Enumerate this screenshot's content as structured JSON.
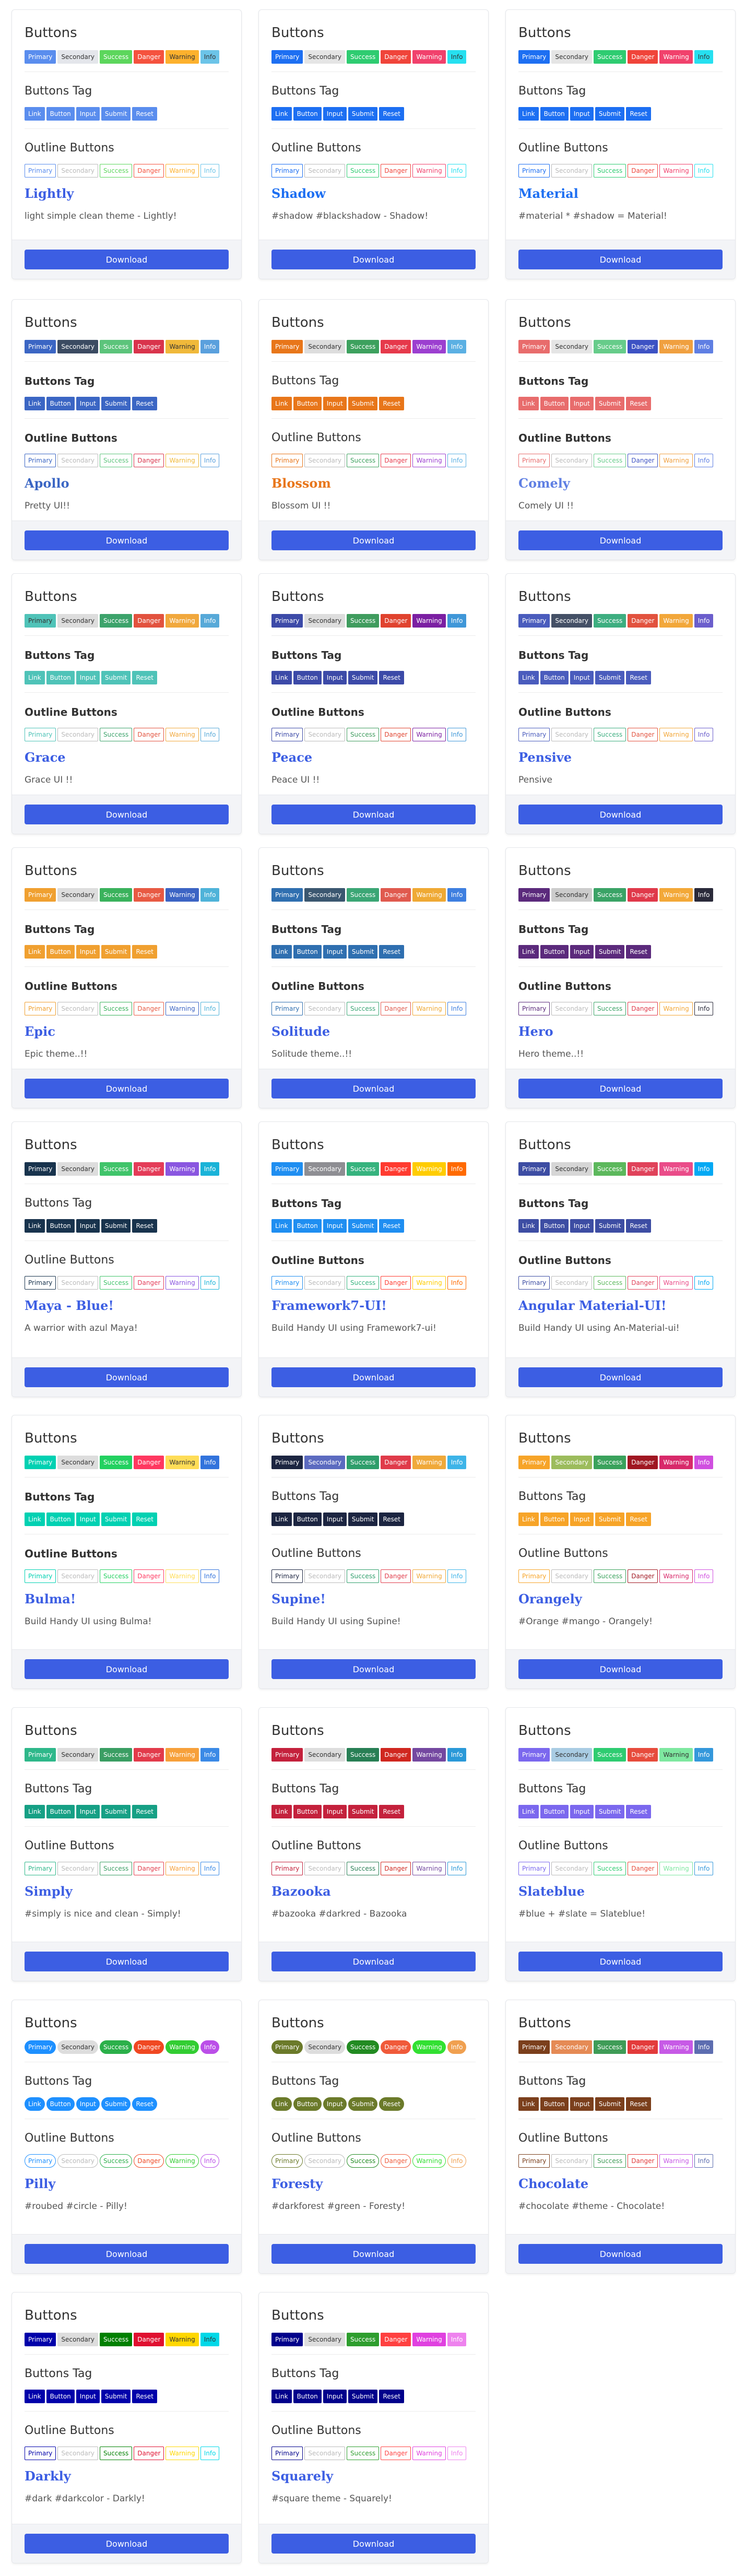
{
  "labels": {
    "main_heading": "Buttons",
    "tag_heading": "Buttons Tag",
    "outline_heading": "Outline Buttons",
    "download": "Download",
    "buttons": [
      "Primary",
      "Secondary",
      "Success",
      "Danger",
      "Warning",
      "Info"
    ],
    "tags": [
      "Link",
      "Button",
      "Input",
      "Submit",
      "Reset"
    ]
  },
  "themes": [
    {
      "name": "Lightly",
      "desc": "light simple clean theme - Lightly!",
      "titleColor": "#3c5ee3",
      "subBold": false,
      "colors": [
        "#5a8dee",
        "#e4e6eb",
        "#5cd65c",
        "#f5523e",
        "#fdb12d",
        "#6cc4e8"
      ],
      "textDark": [
        1,
        4,
        5
      ],
      "tagColor": "#5a8dee",
      "round": false
    },
    {
      "name": "Shadow",
      "desc": "#shadow #blackshadow - Shadow!",
      "titleColor": "#1d6ff2",
      "subBold": false,
      "colors": [
        "#1d6ff2",
        "#e5e5e5",
        "#2ecc71",
        "#f0443a",
        "#f1416c",
        "#26e0f0"
      ],
      "textDark": [
        1,
        5
      ],
      "tagColor": "#1d6ff2",
      "round": false
    },
    {
      "name": "Material",
      "desc": "#material * #shadow = Material!",
      "titleColor": "#1d6ff2",
      "subBold": false,
      "colors": [
        "#1d6ff2",
        "#e5e5e5",
        "#2ecc71",
        "#f0443a",
        "#f1416c",
        "#26e0f0"
      ],
      "textDark": [
        1,
        5
      ],
      "tagColor": "#1d6ff2",
      "round": false
    },
    {
      "name": "Apollo",
      "desc": "Pretty UI!!",
      "titleColor": "#3b66c4",
      "subBold": true,
      "colors": [
        "#3b66c4",
        "#3b4b62",
        "#5cc47b",
        "#d9344c",
        "#f0b93a",
        "#5aa0dd"
      ],
      "textDark": [
        4
      ],
      "tagColor": "#3b66c4",
      "round": false
    },
    {
      "name": "Blossom",
      "desc": "Blossom UI !!",
      "titleColor": "#e8761a",
      "subBold": false,
      "colors": [
        "#e8761a",
        "#dddddd",
        "#3da15e",
        "#e6394b",
        "#9c3fd0",
        "#5bb0e3"
      ],
      "textDark": [
        1
      ],
      "tagColor": "#e8761a",
      "round": false
    },
    {
      "name": "Comely",
      "desc": "Comely UI !!",
      "titleColor": "#5f7fe3",
      "subBold": true,
      "colors": [
        "#e86c6c",
        "#e5e5e5",
        "#66cc8a",
        "#3d52c4",
        "#f0a040",
        "#5f7fe3"
      ],
      "textDark": [
        1
      ],
      "tagColor": "#e86c6c",
      "round": false
    },
    {
      "name": "Grace",
      "desc": "Grace UI !!",
      "titleColor": "#3c5ee3",
      "subBold": true,
      "colors": [
        "#4fc3b8",
        "#dddddd",
        "#3ca36b",
        "#e2523e",
        "#f1a83c",
        "#57a9d8"
      ],
      "textDark": [
        0,
        1
      ],
      "tagColor": "#4fc3b8",
      "round": false
    },
    {
      "name": "Peace",
      "desc": "Peace UI !!",
      "titleColor": "#3c5ee3",
      "subBold": true,
      "colors": [
        "#3c4aa8",
        "#dddddd",
        "#3f9c5e",
        "#e0422e",
        "#7b1fa2",
        "#3f97d8"
      ],
      "textDark": [
        1
      ],
      "tagColor": "#3c4aa8",
      "round": false
    },
    {
      "name": "Pensive",
      "desc": "Pensive",
      "titleColor": "#3c5ee3",
      "subBold": true,
      "colors": [
        "#4a5cbd",
        "#445066",
        "#3dae80",
        "#e2523e",
        "#f2a73a",
        "#6b5ecc"
      ],
      "textDark": [],
      "tagColor": "#4a5cbd",
      "round": false
    },
    {
      "name": "Epic",
      "desc": "Epic theme..!!",
      "titleColor": "#3c5ee3",
      "subBold": true,
      "colors": [
        "#f0a030",
        "#dddddd",
        "#3ab25c",
        "#e85a43",
        "#3c64c4",
        "#4fb3d9"
      ],
      "textDark": [
        1
      ],
      "tagColor": "#f0a030",
      "round": false
    },
    {
      "name": "Solitude",
      "desc": "Solitude theme..!!",
      "titleColor": "#3c5ee3",
      "subBold": true,
      "colors": [
        "#2f6fb0",
        "#3b5770",
        "#3ba675",
        "#e05a4e",
        "#efa934",
        "#3e7fe0"
      ],
      "textDark": [],
      "tagColor": "#2f6fb0",
      "round": false
    },
    {
      "name": "Hero",
      "desc": "Hero theme..!!",
      "titleColor": "#3c5ee3",
      "subBold": true,
      "colors": [
        "#5b2a7c",
        "#cccccc",
        "#3aa366",
        "#e0394a",
        "#f3a838",
        "#2a2a3a"
      ],
      "textDark": [
        1
      ],
      "tagColor": "#5b2a7c",
      "round": false
    },
    {
      "name": "Maya - Blue!",
      "desc": "A warrior with azul Maya!",
      "titleColor": "#3c5ee3",
      "subBold": false,
      "colors": [
        "#18334d",
        "#dddddd",
        "#40c46a",
        "#e43c58",
        "#8a56e0",
        "#1ab3d8"
      ],
      "textDark": [
        1
      ],
      "tagColor": "#18334d",
      "round": false
    },
    {
      "name": "Framework7-UI!",
      "desc": "Build Handy UI using Framework7-ui!",
      "titleColor": "#3c5ee3",
      "subBold": true,
      "colors": [
        "#1f8ef1",
        "#8e8e93",
        "#36b37e",
        "#ff3b30",
        "#ffcc00",
        "#ff6a00"
      ],
      "textDark": [],
      "tagColor": "#1f8ef1",
      "round": false
    },
    {
      "name": "Angular Material-UI!",
      "desc": "Build Handy UI using An-Material-ui!",
      "titleColor": "#3c5ee3",
      "subBold": true,
      "colors": [
        "#3d4da3",
        "#d6d6d6",
        "#5cb85c",
        "#e0425a",
        "#ea4c89",
        "#03a9f4"
      ],
      "textDark": [
        1
      ],
      "tagColor": "#3d4da3",
      "round": false
    },
    {
      "name": "Bulma!",
      "desc": "Build Handy UI using Bulma!",
      "titleColor": "#3c5ee3",
      "subBold": true,
      "colors": [
        "#00d1b2",
        "#dddddd",
        "#23d160",
        "#ff3860",
        "#ffdd57",
        "#3273dc"
      ],
      "textDark": [
        1,
        4
      ],
      "tagColor": "#00d1b2",
      "round": false
    },
    {
      "name": "Supine!",
      "desc": "Build Handy UI using Supine!",
      "titleColor": "#3c5ee3",
      "subBold": false,
      "colors": [
        "#1c2541",
        "#5c6bc0",
        "#2e9e6b",
        "#e03b4a",
        "#f0a93a",
        "#3db4e8"
      ],
      "textDark": [],
      "tagColor": "#1c2541",
      "round": false
    },
    {
      "name": "Orangely",
      "desc": "#Orange #mango - Orangely!",
      "titleColor": "#3c5ee3",
      "subBold": false,
      "colors": [
        "#f7a428",
        "#9cbc5c",
        "#3aa25c",
        "#a01722",
        "#d8296a",
        "#d04fe0"
      ],
      "textDark": [],
      "tagColor": "#f7a428",
      "round": false
    },
    {
      "name": "Simply",
      "desc": "#simply is nice and clean - Simply!",
      "titleColor": "#3c5ee3",
      "subBold": false,
      "colors": [
        "#2eb88a",
        "#dddddd",
        "#3a9e63",
        "#e23b4b",
        "#f7a03a",
        "#3b8ae6"
      ],
      "textDark": [
        1
      ],
      "tagColor": "#16a085",
      "round": false
    },
    {
      "name": "Bazooka",
      "desc": "#bazooka #darkred - Bazooka",
      "titleColor": "#3c5ee3",
      "subBold": false,
      "colors": [
        "#c4213c",
        "#dddddd",
        "#287f55",
        "#d0271f",
        "#7448a0",
        "#2a99d8"
      ],
      "textDark": [
        1
      ],
      "tagColor": "#c4213c",
      "round": false
    },
    {
      "name": "Slateblue",
      "desc": "#blue + #slate = Slateblue!",
      "titleColor": "#3c5ee3",
      "subBold": false,
      "colors": [
        "#7b68ee",
        "#a9cce3",
        "#2ecc71",
        "#e74c3c",
        "#7ee8a0",
        "#3498db"
      ],
      "textDark": [
        1,
        4
      ],
      "tagColor": "#7b68ee",
      "round": false
    },
    {
      "name": "Pilly",
      "desc": "#roubed #circle - Pilly!",
      "titleColor": "#3c5ee3",
      "subBold": false,
      "colors": [
        "#1e90ff",
        "#dddddd",
        "#2bb04a",
        "#f04822",
        "#32cd32",
        "#bb4fe8"
      ],
      "textDark": [
        1
      ],
      "tagColor": "#1e90ff",
      "round": true
    },
    {
      "name": "Foresty",
      "desc": "#darkforest #green - Foresty!",
      "titleColor": "#3c5ee3",
      "subBold": false,
      "colors": [
        "#6b7a2a",
        "#dddddd",
        "#228b22",
        "#f05a3a",
        "#32e032",
        "#f0a050"
      ],
      "textDark": [
        1
      ],
      "tagColor": "#6b7a2a",
      "round": true
    },
    {
      "name": "Chocolate",
      "desc": "#chocolate #theme - Chocolate!",
      "titleColor": "#3c5ee3",
      "subBold": false,
      "colors": [
        "#7b3f1c",
        "#e58a55",
        "#3f9c57",
        "#e33b3b",
        "#c75ae6",
        "#5d6db0"
      ],
      "textDark": [],
      "tagColor": "#7b3f1c",
      "round": false
    },
    {
      "name": "Darkly",
      "desc": "#dark #darkcolor - Darkly!",
      "titleColor": "#3c5ee3",
      "subBold": false,
      "colors": [
        "#0000aa",
        "#dddddd",
        "#008000",
        "#e01030",
        "#ffd700",
        "#00d8e8"
      ],
      "textDark": [
        1,
        4,
        5
      ],
      "tagColor": "#0000aa",
      "round": false
    },
    {
      "name": "Squarely",
      "desc": "#square theme - Squarely!",
      "titleColor": "#3c5ee3",
      "subBold": false,
      "colors": [
        "#00008b",
        "#dddddd",
        "#2e9e2e",
        "#ff4040",
        "#e040e0",
        "#ee82ee"
      ],
      "textDark": [
        1
      ],
      "tagColor": "#00008b",
      "round": false
    }
  ]
}
